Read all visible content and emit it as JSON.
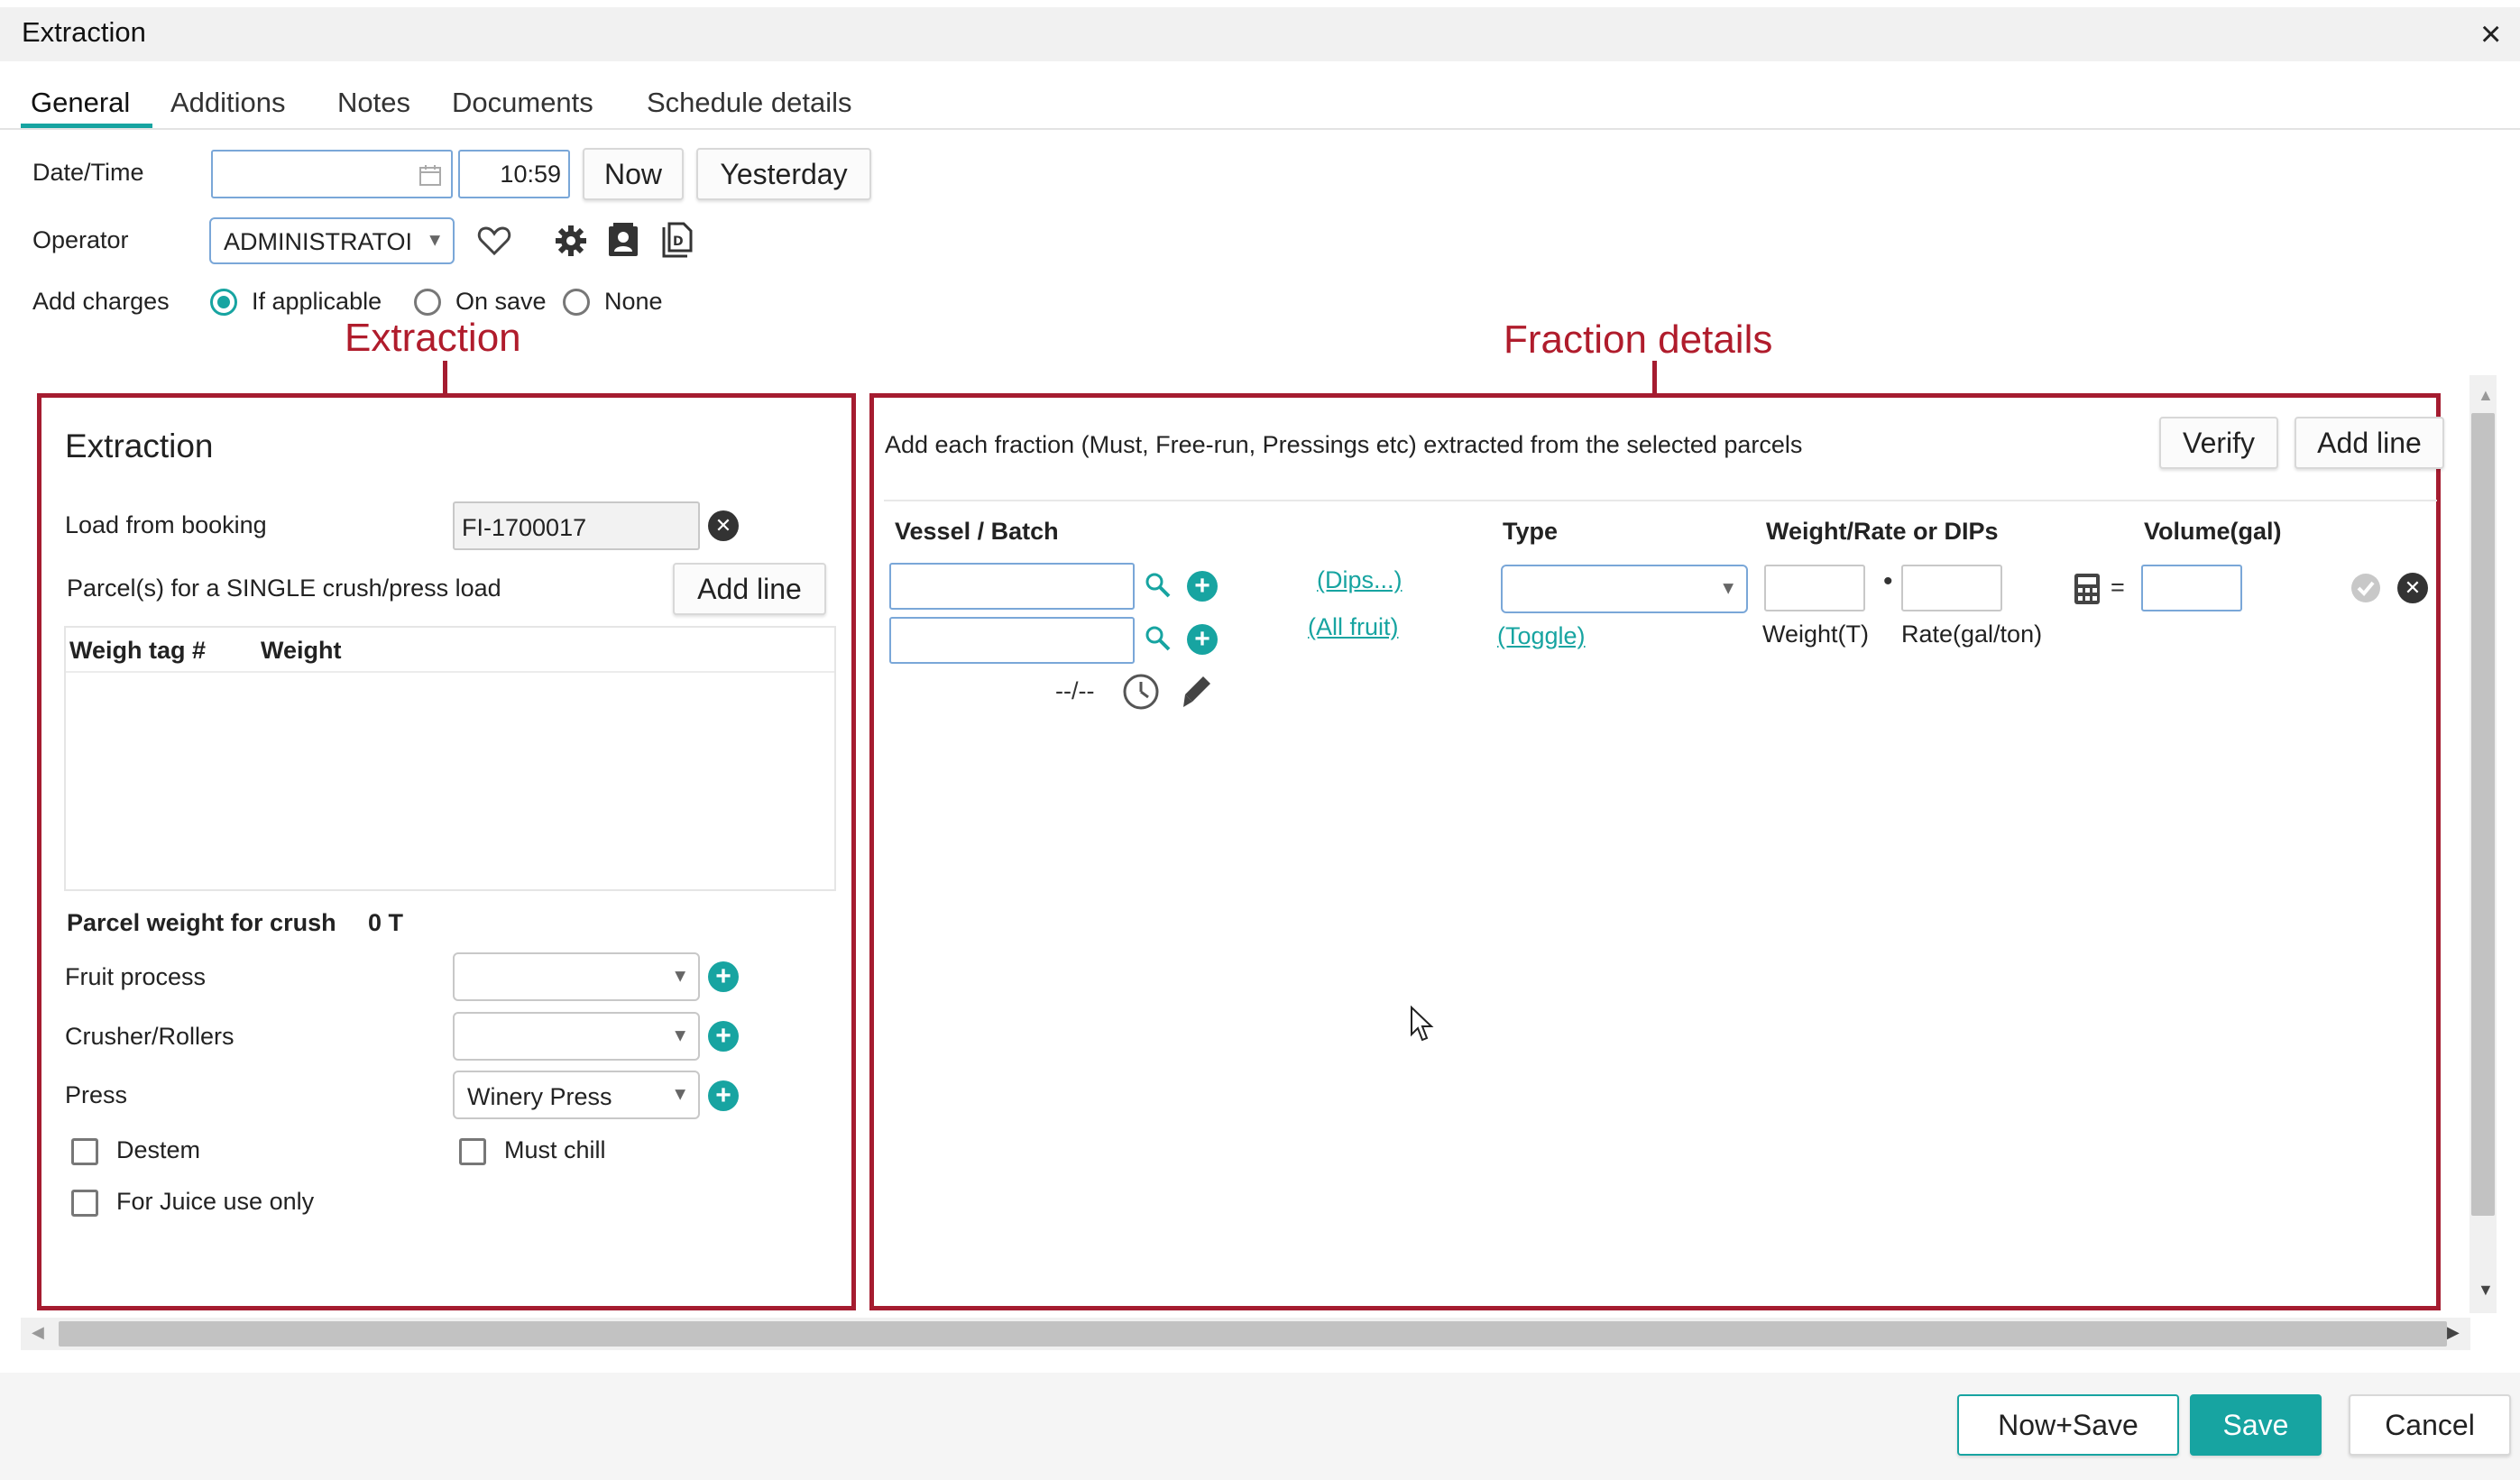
{
  "window": {
    "title": "Extraction",
    "close_label": "×"
  },
  "tabs": [
    {
      "label": "General",
      "active": true
    },
    {
      "label": "Additions"
    },
    {
      "label": "Notes"
    },
    {
      "label": "Documents"
    },
    {
      "label": "Schedule details"
    }
  ],
  "form": {
    "datetime_label": "Date/Time",
    "date_value": "",
    "time_value": "10:59",
    "now_label": "Now",
    "yesterday_label": "Yesterday",
    "operator_label": "Operator",
    "operator_value": "ADMINISTRATOI",
    "add_charges_label": "Add charges",
    "charges_options": [
      "If applicable",
      "On save",
      "None"
    ],
    "charges_selected": "If applicable"
  },
  "annotations": {
    "extraction": "Extraction",
    "fraction": "Fraction details"
  },
  "extraction": {
    "heading": "Extraction",
    "load_from_booking_label": "Load from booking",
    "booking_value": "FI-1700017",
    "parcels_label": "Parcel(s) for a SINGLE crush/press load",
    "add_line_label": "Add line",
    "columns": [
      "Weigh tag #",
      "Weight"
    ],
    "parcel_weight_label": "Parcel weight for crush",
    "parcel_weight_value": "0 T",
    "fruit_process_label": "Fruit process",
    "fruit_process_value": "",
    "crusher_label": "Crusher/Rollers",
    "crusher_value": "",
    "press_label": "Press",
    "press_value": "Winery Press",
    "destem_label": "Destem",
    "must_chill_label": "Must chill",
    "juice_label": "For Juice use only"
  },
  "fraction": {
    "description": "Add each fraction (Must, Free-run, Pressings etc) extracted from the selected parcels",
    "verify_label": "Verify",
    "add_line_label": "Add line",
    "columns": {
      "vessel": "Vessel / Batch",
      "type": "Type",
      "weight_rate": "Weight/Rate or DIPs",
      "volume": "Volume(gal)"
    },
    "dips_link": "(Dips...)",
    "all_fruit_link": "(All fruit)",
    "toggle_link": "(Toggle)",
    "date_placeholder": "--/--",
    "weight_label": "Weight(T)",
    "rate_label": "Rate(gal/ton)",
    "multiply_symbol": "•",
    "equals_symbol": "="
  },
  "footer": {
    "now_save_label": "Now+Save",
    "save_label": "Save",
    "cancel_label": "Cancel"
  },
  "colors": {
    "accent": "#17a4a1",
    "annotation": "#a51c30"
  }
}
